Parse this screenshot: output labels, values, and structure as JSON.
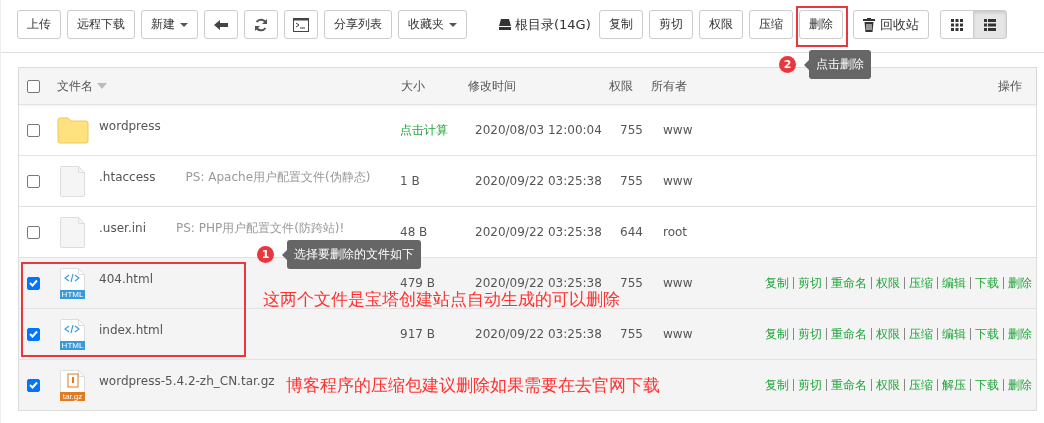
{
  "toolbar": {
    "buttons": [
      {
        "kind": "text",
        "label": "上传"
      },
      {
        "kind": "text",
        "label": "远程下载"
      },
      {
        "kind": "dropdown",
        "label": "新建"
      },
      {
        "kind": "back"
      },
      {
        "kind": "refresh"
      },
      {
        "kind": "terminal"
      },
      {
        "kind": "text",
        "label": "分享列表"
      },
      {
        "kind": "dropdown",
        "label": "收藏夹"
      }
    ],
    "disk": "根目录(14G)",
    "actions": [
      {
        "label": "复制",
        "highlighted": false
      },
      {
        "label": "剪切",
        "highlighted": false
      },
      {
        "label": "权限",
        "highlighted": false
      },
      {
        "label": "压缩",
        "highlighted": false
      },
      {
        "label": "删除",
        "highlighted": true
      }
    ],
    "recycle": "回收站",
    "views": [
      {
        "kind": "grid",
        "selected": false
      },
      {
        "kind": "list",
        "selected": true
      }
    ]
  },
  "table": {
    "header_checked": false,
    "columns": [
      "文件名",
      "大小",
      "修改时间",
      "权限",
      "所有者",
      "操作"
    ],
    "rows": [
      {
        "checked": false,
        "icon": {
          "kind": "folder"
        },
        "name": "wordpress",
        "size": "点击计算",
        "size_link": true,
        "modified": "2020/08/03 12:00:04",
        "perm": "755",
        "owner": "www"
      },
      {
        "checked": false,
        "icon": {
          "kind": "file"
        },
        "name": ".htaccess",
        "note": "PS: Apache用户配置文件(伪静态)",
        "size": "1 B",
        "size_link": false,
        "modified": "2020/09/22 03:25:38",
        "perm": "755",
        "owner": "www"
      },
      {
        "checked": false,
        "icon": {
          "kind": "file"
        },
        "name": ".user.ini",
        "note": "PS: PHP用户配置文件(防跨站)!",
        "size": "48 B",
        "size_link": false,
        "modified": "2020/09/22 03:25:38",
        "perm": "644",
        "owner": "root"
      },
      {
        "checked": true,
        "icon": {
          "kind": "html",
          "label": "HTML"
        },
        "name": "404.html",
        "size": "479 B",
        "size_link": false,
        "modified": "2020/09/22 03:25:38",
        "perm": "755",
        "owner": "www",
        "actions": [
          "复制",
          "剪切",
          "重命名",
          "权限",
          "压缩",
          "编辑",
          "下载",
          "删除"
        ]
      },
      {
        "checked": true,
        "icon": {
          "kind": "html",
          "label": "HTML"
        },
        "name": "index.html",
        "size": "917 B",
        "size_link": false,
        "modified": "2020/09/22 03:25:38",
        "perm": "755",
        "owner": "www",
        "actions": [
          "复制",
          "剪切",
          "重命名",
          "权限",
          "压缩",
          "编辑",
          "下载",
          "删除"
        ]
      },
      {
        "checked": true,
        "icon": {
          "kind": "archive",
          "label": "tar.gz"
        },
        "name": "wordpress-5.4.2-zh_CN.tar.gz",
        "actions": [
          "复制",
          "剪切",
          "重命名",
          "权限",
          "压缩",
          "解压",
          "下载",
          "删除"
        ]
      }
    ]
  },
  "annotations": {
    "callouts": [
      {
        "number": "1",
        "text": "选择要删除的文件如下"
      },
      {
        "number": "2",
        "text": "点击删除"
      }
    ],
    "notes": [
      "这两个文件是宝塔创建站点自动生成的可以删除",
      "博客程序的压缩包建议删除如果需要在去官网下载"
    ]
  }
}
